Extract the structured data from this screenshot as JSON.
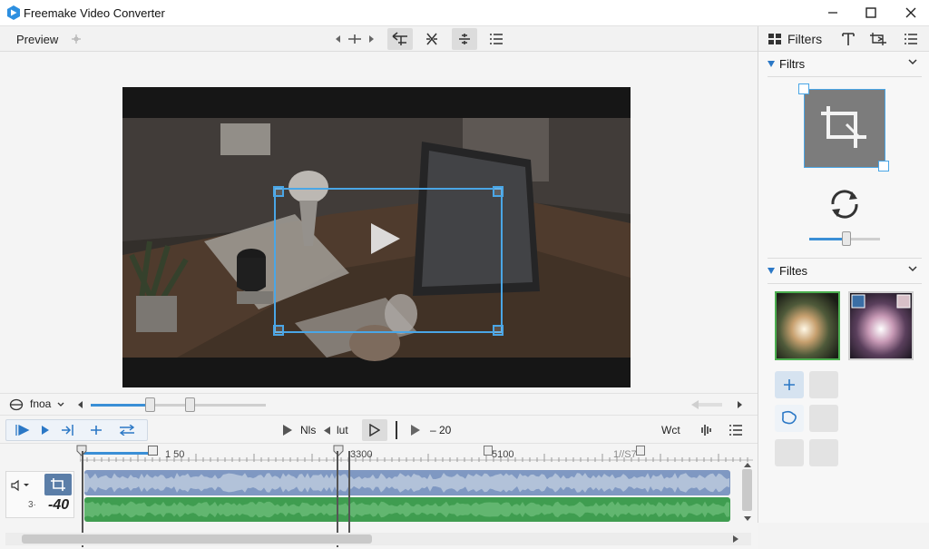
{
  "window": {
    "title": "Freemake Video Converter",
    "controls": [
      "minimize-icon",
      "maximize-icon",
      "close-icon"
    ]
  },
  "toolbar": {
    "preview_label": "Preview",
    "tools": [
      "prev-next-icon",
      "split-icon",
      "crop-tool-icon",
      "cut-icon",
      "align-icon",
      "list-icon"
    ]
  },
  "seek": {
    "mode_label": "fnoa",
    "slider_value": 0.37
  },
  "controls": {
    "left_buttons": [
      "play-start-icon",
      "play-icon",
      "step-icon",
      "marker-icon",
      "swap-icon"
    ],
    "mid_label_1": "Nls",
    "mid_label_2": "lut",
    "mid_value": "– 20",
    "right_label": "Wct"
  },
  "timeline": {
    "ruler_labels": [
      "1 50",
      "3300",
      "5100",
      "1//S7"
    ],
    "track_value": "-40",
    "track_prefix": "3·"
  },
  "right_panel": {
    "toolbar_label": "Filters",
    "section_1": "Filtrs",
    "section_2": "Filtes",
    "rotate_slider_value": 0.5
  },
  "colors": {
    "accent": "#4aa6e6",
    "audio_track": "#7f98c2",
    "video_track": "#3f9d50",
    "section_triangle": "#2b78c6"
  }
}
